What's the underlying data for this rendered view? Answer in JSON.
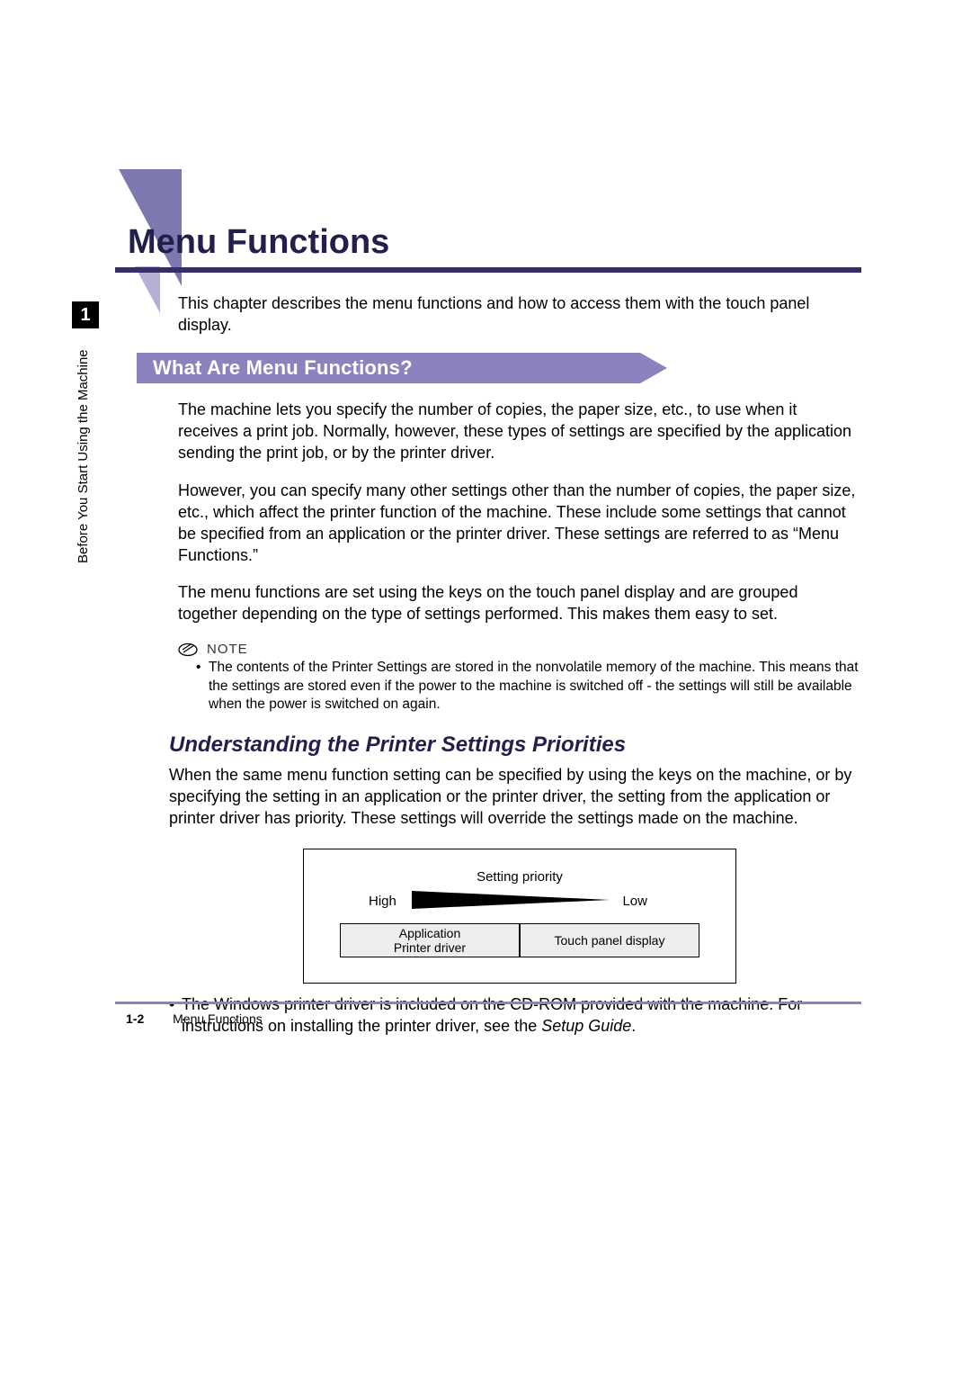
{
  "page": {
    "title": "Menu Functions",
    "chapter_number": "1",
    "side_label": "Before You Start Using the Machine",
    "intro": "This chapter describes the menu functions and how to access them with the touch panel display."
  },
  "section1": {
    "heading": "What Are Menu Functions?",
    "p1": "The machine lets you specify the number of copies, the paper size, etc., to use when it receives a print job. Normally, however, these types of settings are specified by the application sending the print job, or by the printer driver.",
    "p2": "However, you can specify many other settings other than the number of copies, the paper size, etc., which affect the printer function of the machine. These include some settings that cannot be specified from an application or the printer driver. These settings are referred to as “Menu Functions.”",
    "p3": "The menu functions are set using the keys on the touch panel display and are grouped together depending on the type of settings performed. This makes them easy to set."
  },
  "note": {
    "label": "NOTE",
    "item": "The contents of the Printer Settings are stored in the nonvolatile memory of the machine. This means that the settings are stored even if the power to the machine is switched off - the settings will still be available when the power is switched on again."
  },
  "section2": {
    "heading": "Understanding the Printer Settings Priorities",
    "p1": "When the same menu function setting can be specified by using the keys on the machine, or by specifying the setting in an application or the printer driver, the setting from the application or printer driver has priority. These settings will override the settings made on the machine."
  },
  "diagram": {
    "title": "Setting priority",
    "high": "High",
    "low": "Low",
    "left_cell_line1": "Application",
    "left_cell_line2": "Printer driver",
    "right_cell": "Touch panel display"
  },
  "closing": {
    "bullet_pre": "The Windows printer driver is included on the CD-ROM provided with the machine. For instructions on installing the printer driver, see the ",
    "bullet_em": "Setup Guide",
    "bullet_post": "."
  },
  "footer": {
    "page_number": "1-2",
    "running_title": "Menu Functions"
  }
}
